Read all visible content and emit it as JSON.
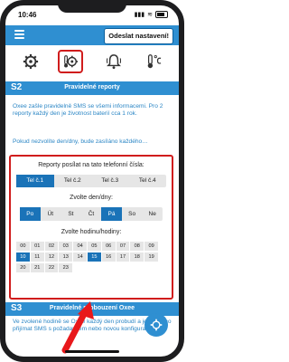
{
  "status": {
    "time": "10:46",
    "signal": "▮▮▮",
    "wifi": "≋"
  },
  "header": {
    "send_label": "Odeslat nastavení!"
  },
  "tabs": [
    {
      "name": "gear"
    },
    {
      "name": "temperature-gear",
      "active": true
    },
    {
      "name": "bell"
    },
    {
      "name": "thermometer-celsius"
    }
  ],
  "section2": {
    "num": "S2",
    "title": "Pravidelné reporty",
    "p1": "Oxee zašle pravidelně SMS se všemi informacemi. Pro 2 reporty každý den je životnost baterií cca 1 rok.",
    "p2": "Pokud nezvolíte den/dny, bude zasíláno každého…"
  },
  "config": {
    "phones_label": "Reporty posílat na tato telefonní čísla:",
    "phones": [
      "Tel č.1",
      "Tel č.2",
      "Tel č.3",
      "Tel č.4"
    ],
    "phones_selected": [
      0
    ],
    "days_label": "Zvolte den/dny:",
    "days": [
      "Po",
      "Út",
      "St",
      "Čt",
      "Pá",
      "So",
      "Ne"
    ],
    "days_selected": [
      0,
      4
    ],
    "hours_label": "Zvolte hodinu/hodiny:",
    "hours": [
      "00",
      "01",
      "02",
      "03",
      "04",
      "05",
      "06",
      "07",
      "08",
      "09",
      "10",
      "11",
      "12",
      "13",
      "14",
      "15",
      "16",
      "17",
      "18",
      "19",
      "20",
      "21",
      "22",
      "23"
    ],
    "hours_selected": [
      10,
      15
    ]
  },
  "section3": {
    "num": "S3",
    "title": "Pravidelné probouzení Oxee",
    "p1": "Ve zvolené hodině se Oxee každý den probudí a je schopno přijímat SMS s požadavkem nebo novou konfigurací."
  },
  "colors": {
    "accent": "#2f8fd1",
    "selected": "#1a73b8",
    "highlight": "#d01c1c"
  }
}
